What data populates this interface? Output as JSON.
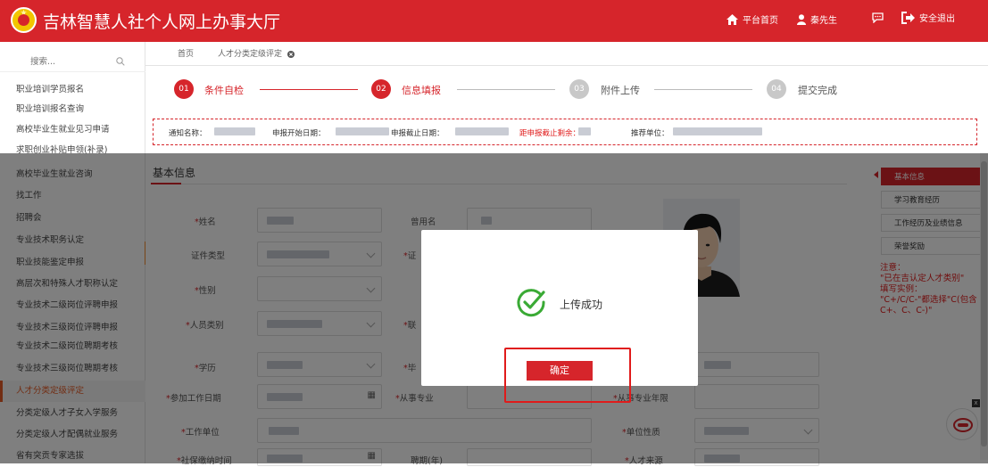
{
  "header": {
    "title": "吉林智慧人社个人网上办事大厅",
    "nav": {
      "home": "平台首页",
      "user": "秦先生",
      "logout": "安全退出"
    }
  },
  "sidebar": {
    "search_placeholder": "搜索...",
    "items": [
      "职业培训学员报名",
      "职业培训报名查询",
      "高校毕业生就业见习申请",
      "求职创业补贴申领(补录)",
      "高校毕业生就业咨询",
      "找工作",
      "招聘会",
      "专业技术职务认定",
      "职业技能鉴定申报",
      "高层次和特殊人才职称认定",
      "专业技术二级岗位评聘申报",
      "专业技术三级岗位评聘申报",
      "专业技术二级岗位聘期考核",
      "专业技术三级岗位聘期考核",
      "人才分类定级评定",
      "分类定级人才子女入学服务",
      "分类定级人才配偶就业服务",
      "省有突贡专家选拔"
    ],
    "active_index": 14
  },
  "tabs": {
    "home": "首页",
    "current": "人才分类定级评定"
  },
  "steps": [
    {
      "num": "01",
      "label": "条件自检",
      "active": true
    },
    {
      "num": "02",
      "label": "信息填报",
      "active": true
    },
    {
      "num": "03",
      "label": "附件上传",
      "active": false
    },
    {
      "num": "04",
      "label": "提交完成",
      "active": false
    }
  ],
  "notice": {
    "name_label": "通知名称：",
    "start_label": "申报开始日期：",
    "end_label": "申报截止日期：",
    "remaining_label": "距申报截止剩余：",
    "recommender_label": "推荐单位："
  },
  "section": {
    "title": "基本信息"
  },
  "form": {
    "name": "姓名",
    "former_name": "曾用名",
    "id_type": "证件类型",
    "id_no_partial": "证",
    "gender": "性别",
    "person_type": "人员类别",
    "person_type_right": "联",
    "education": "学历",
    "education_right": "毕",
    "work_start": "参加工作日期",
    "major": "从事专业",
    "major_years": "从事专业年限",
    "employer": "工作单位",
    "employer_nature": "单位性质",
    "social_time": "社保缴纳时间",
    "hire_years": "聘期(年)",
    "talent_source": "人才来源"
  },
  "right_nav": {
    "items": [
      "基本信息",
      "学习教育经历",
      "工作经历及业绩信息",
      "荣誉奖励"
    ],
    "active_index": 0,
    "notes": [
      "注意：",
      "\"已在吉认定人才类别\"",
      "填写实例：",
      "\"C+/C/C-\"都选择\"C(包含C+、C、C-)\""
    ]
  },
  "modal": {
    "message": "上传成功",
    "ok_label": "确定"
  },
  "float_close": "x",
  "colors": {
    "primary": "#d6252b",
    "success": "#3aaa35",
    "active_menu": "#e45b27"
  }
}
